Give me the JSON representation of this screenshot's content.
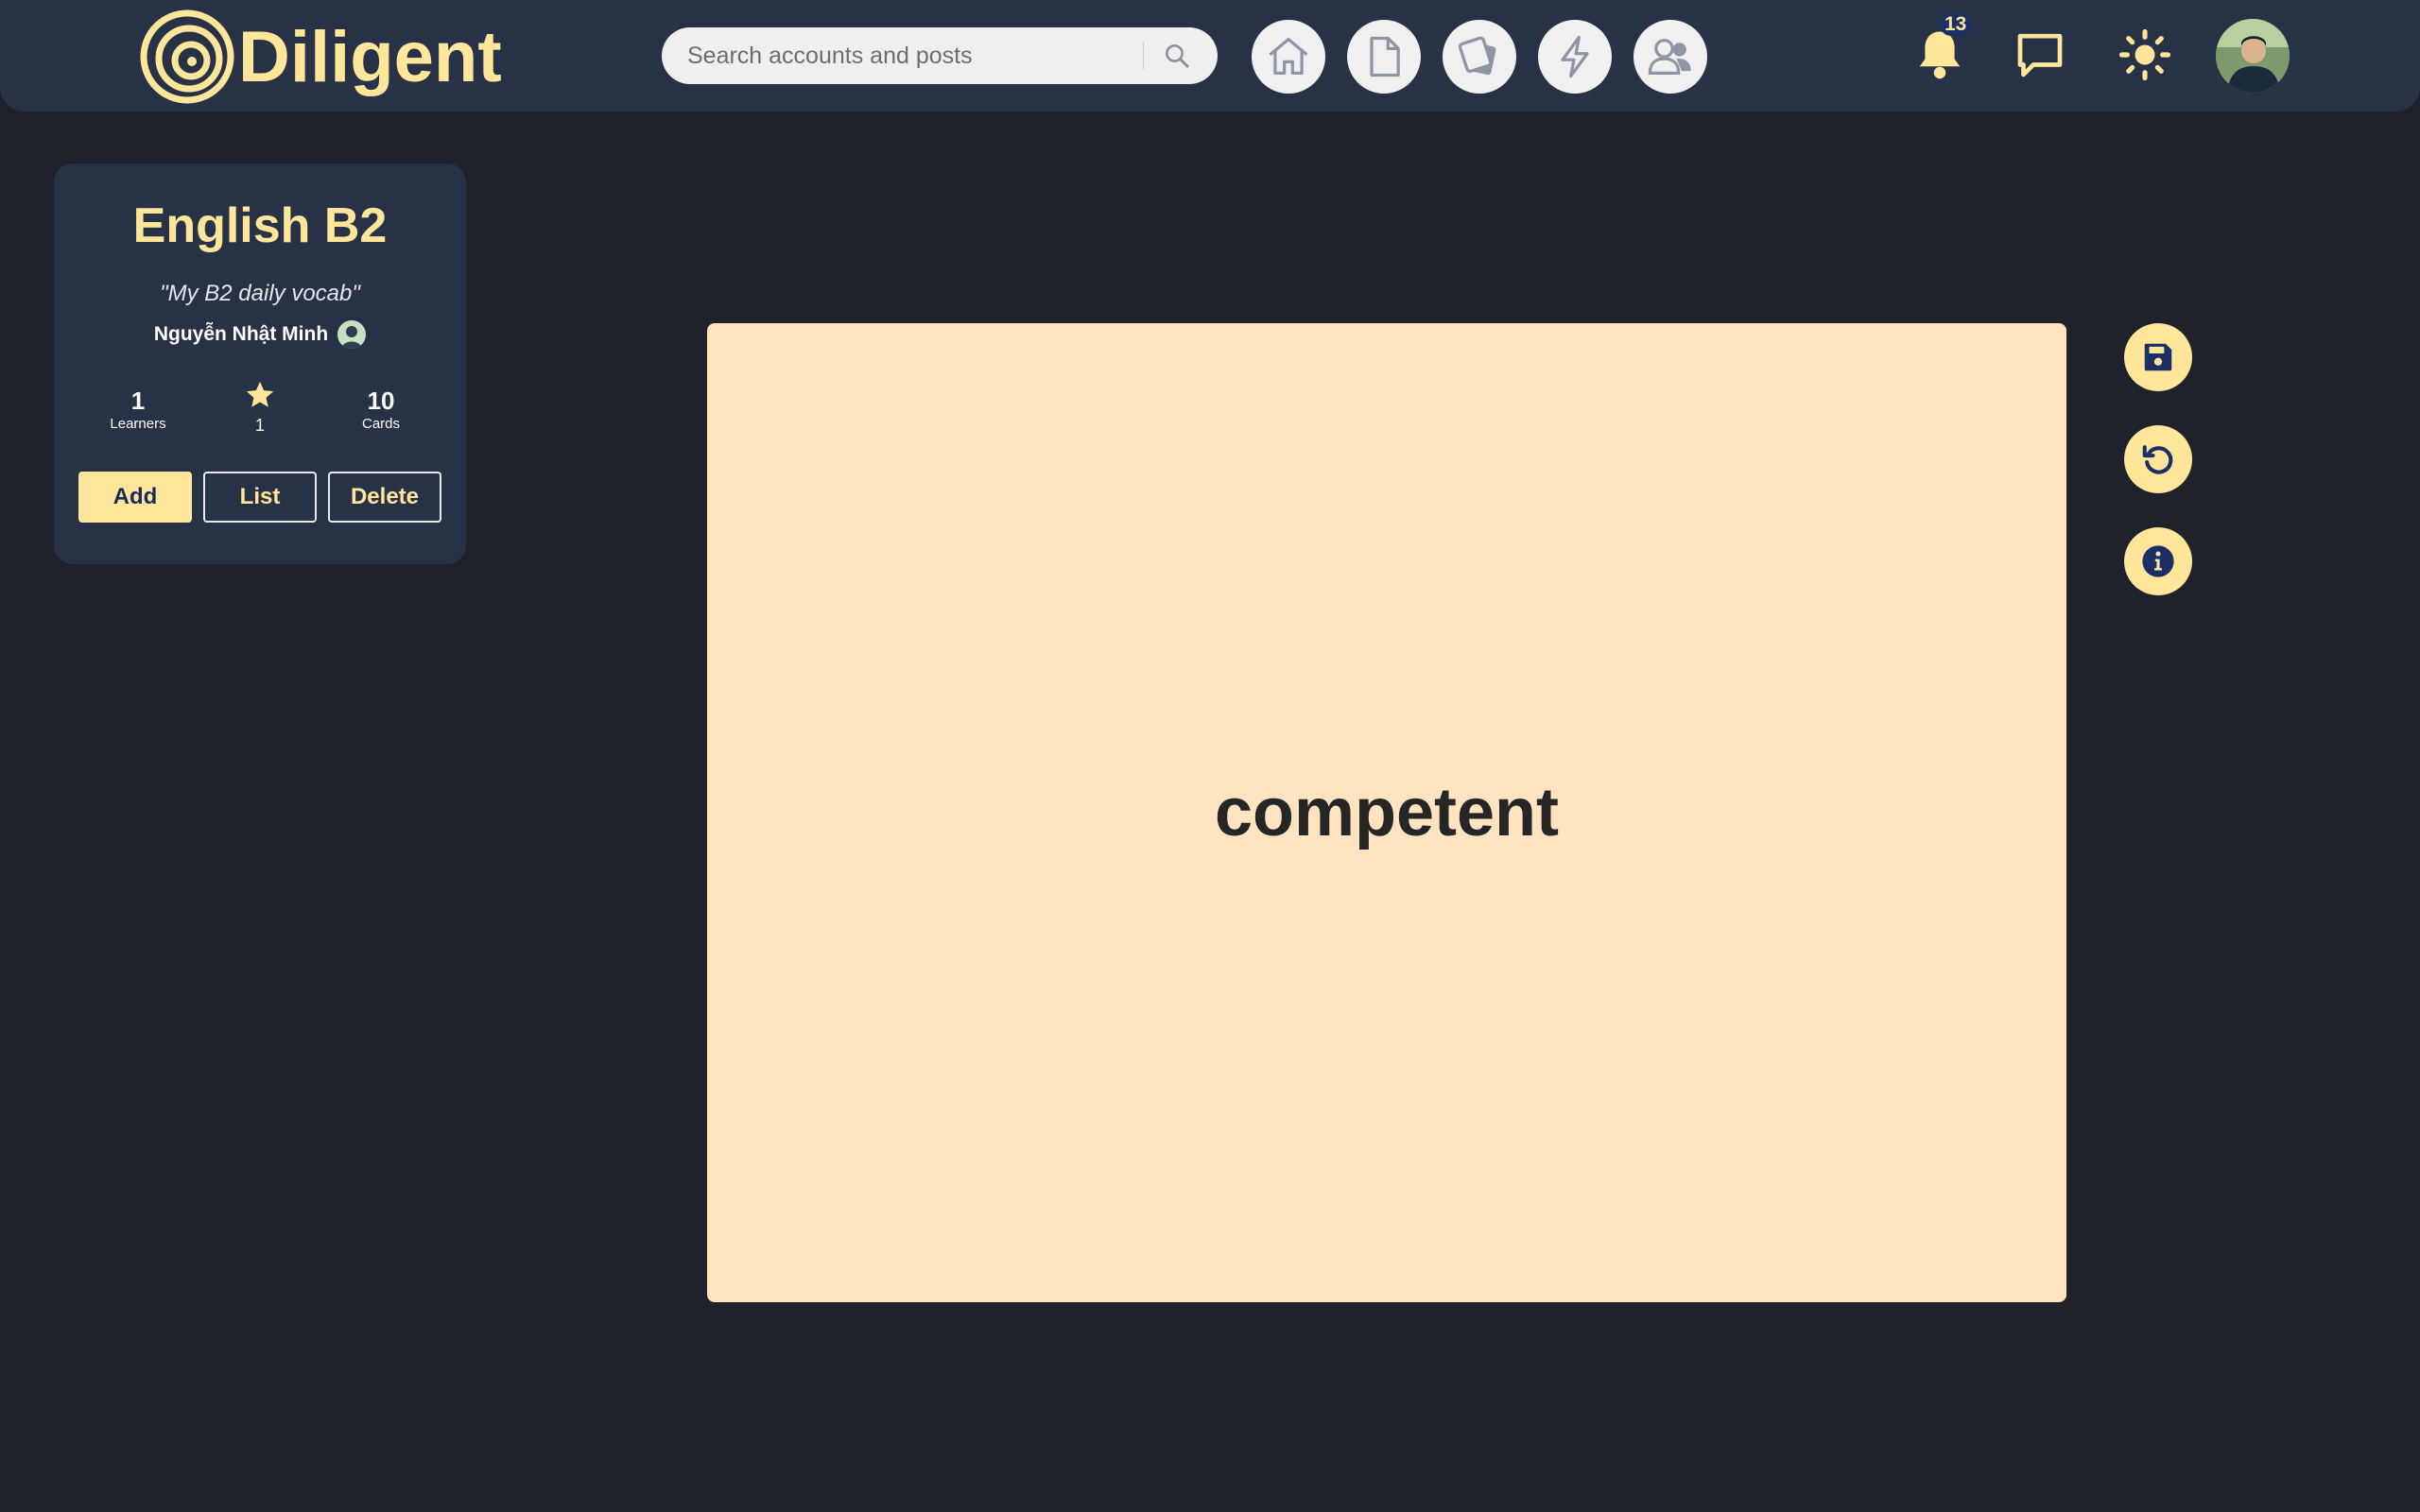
{
  "header": {
    "app_name": "Diligent",
    "search": {
      "placeholder": "Search accounts and posts",
      "value": ""
    },
    "nav": [
      {
        "name": "home",
        "icon": "home-icon"
      },
      {
        "name": "documents",
        "icon": "document-icon"
      },
      {
        "name": "flashcards",
        "icon": "cards-icon"
      },
      {
        "name": "quick",
        "icon": "lightning-icon"
      },
      {
        "name": "people",
        "icon": "users-icon"
      }
    ],
    "notifications": {
      "icon": "bell-icon",
      "count": "13"
    },
    "messages_icon": "chat-icon",
    "theme_icon": "sun-icon",
    "colors": {
      "bar": "#283246",
      "accent": "#ffe69b",
      "page": "#1f222b"
    }
  },
  "deck": {
    "title": "English B2",
    "description": "\"My B2 daily vocab\"",
    "owner": "Nguyễn Nhật Minh",
    "stats": {
      "learners_value": "1",
      "learners_label": "Learners",
      "stars_value": "1",
      "cards_value": "10",
      "cards_label": "Cards"
    },
    "buttons": {
      "add": "Add",
      "list": "List",
      "delete": "Delete"
    }
  },
  "flashcard": {
    "term": "competent",
    "color": "#ffe4c2"
  },
  "actions": [
    {
      "name": "save",
      "icon": "save-icon"
    },
    {
      "name": "flip",
      "icon": "rotate-icon"
    },
    {
      "name": "info",
      "icon": "info-icon"
    }
  ]
}
